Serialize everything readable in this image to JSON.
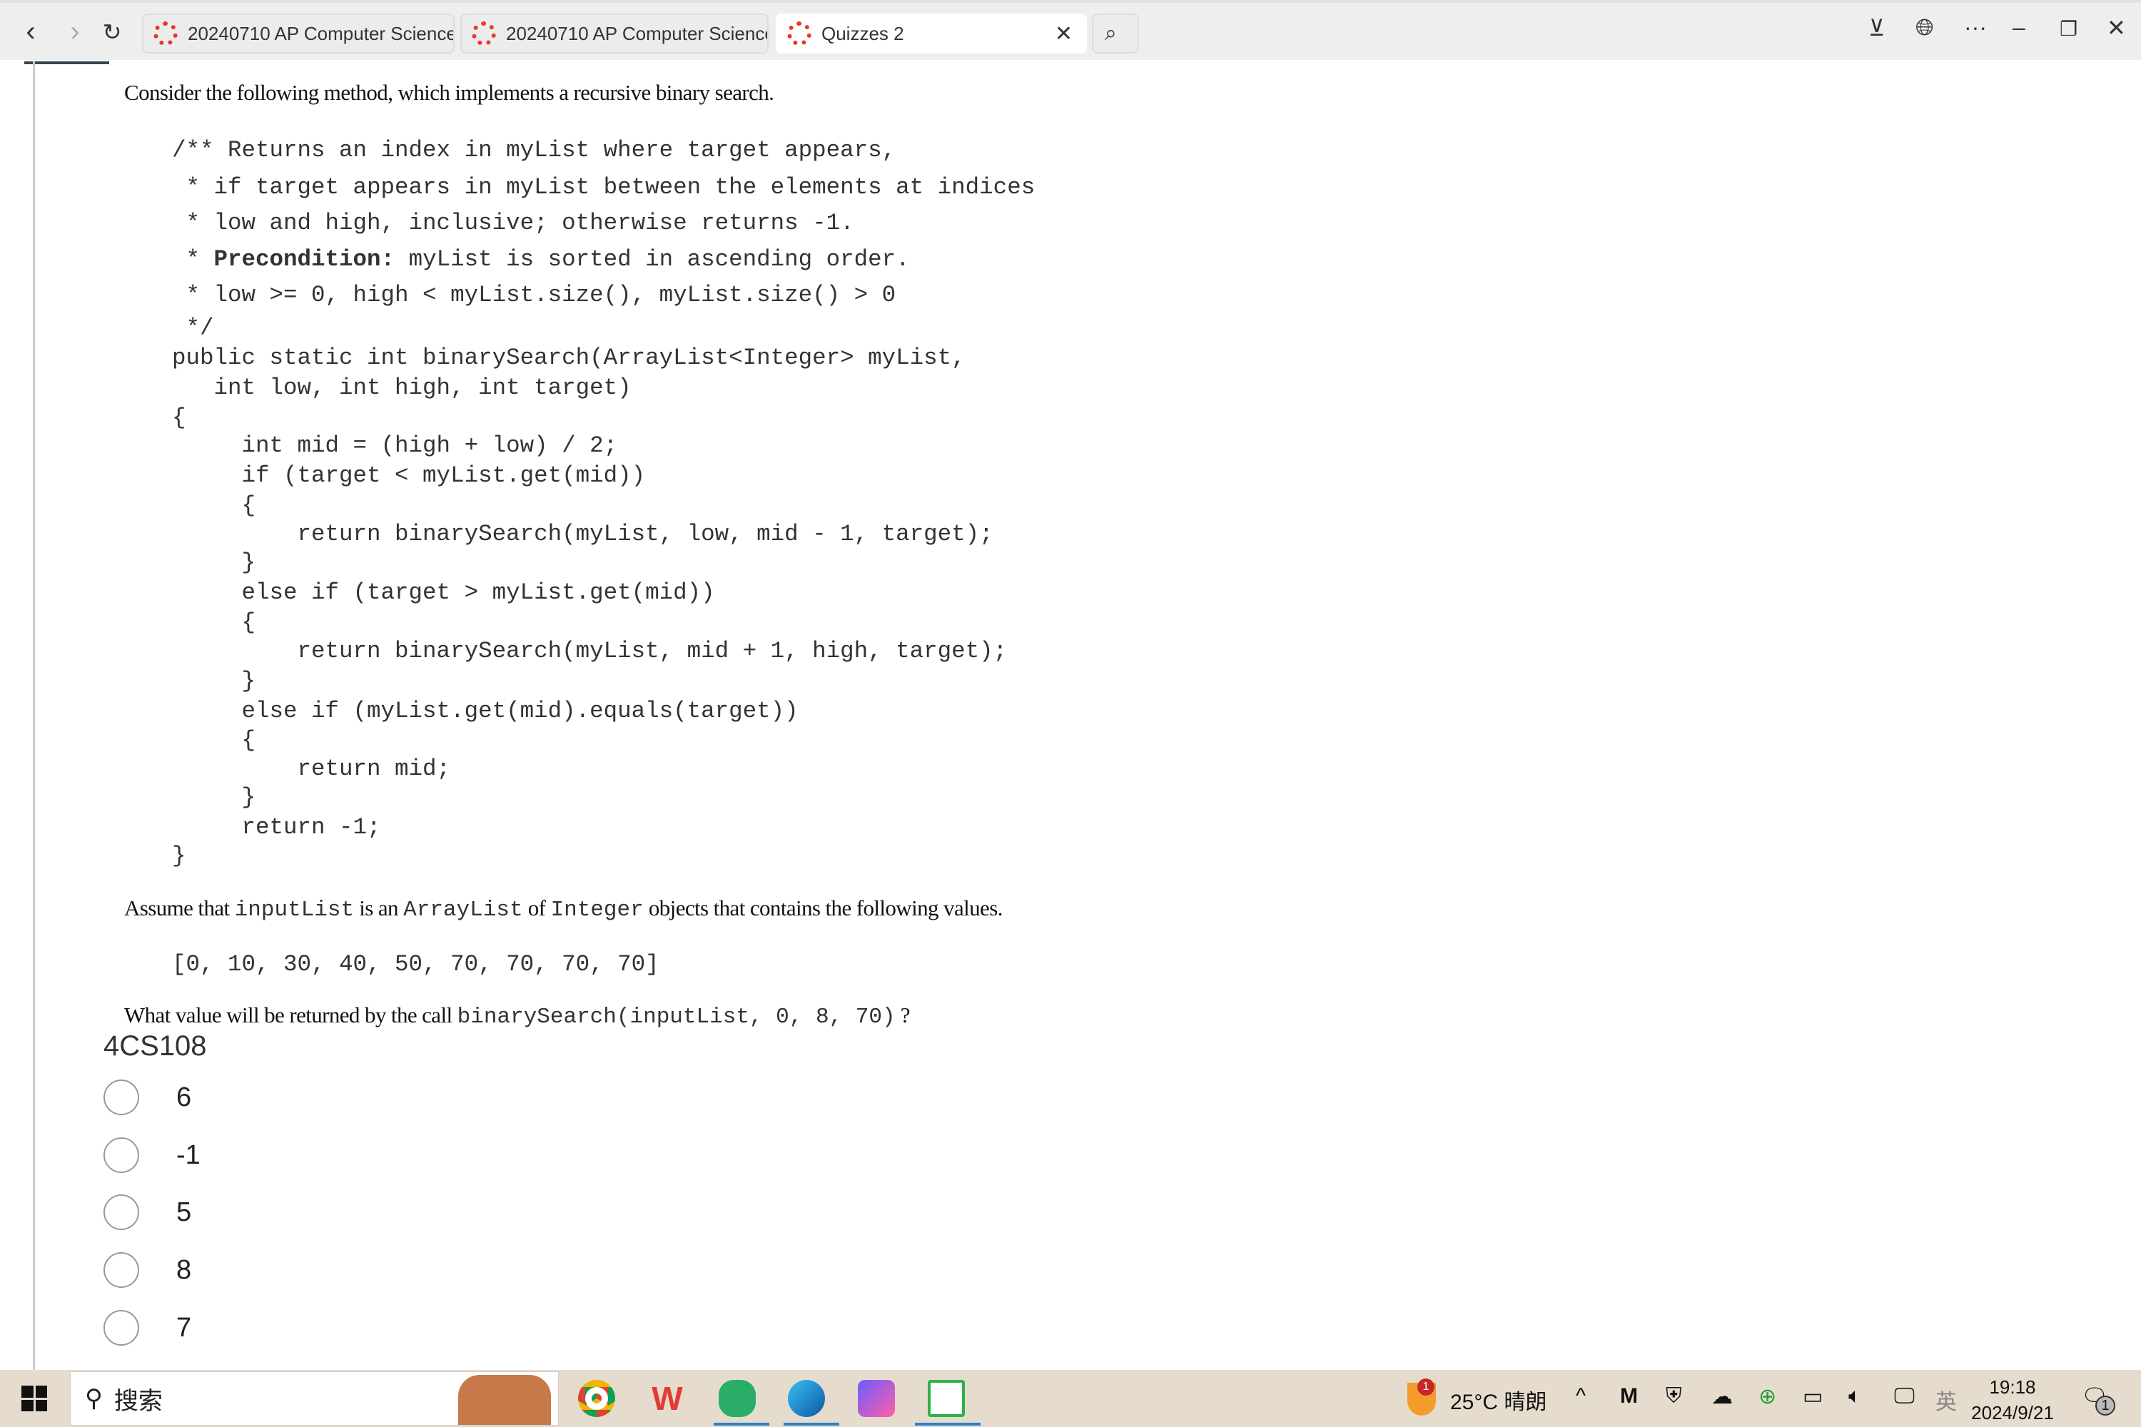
{
  "browser": {
    "tabs": [
      {
        "label": "20240710 AP Computer Science",
        "active": false
      },
      {
        "label": "20240710 AP Computer Science",
        "active": false
      },
      {
        "label": "Quizzes 2",
        "active": true
      }
    ],
    "icons": [
      "back-icon",
      "forward-icon",
      "refresh-icon",
      "search-tabs-icon",
      "download-icon",
      "globe-icon",
      "more-icon",
      "minimize-icon",
      "restore-icon",
      "close-icon"
    ]
  },
  "question": {
    "intro": "Consider the following method, which implements a recursive binary search.",
    "code": [
      "/** Returns an index in myList where target appears,",
      " * if target appears in myList between the elements at indices",
      " * low and high, inclusive; otherwise returns -1.",
      " * ",
      " * low >= 0, high < myList.size(), myList.size() > 0",
      " */",
      "public static int binarySearch(ArrayList<Integer> myList,",
      "   int low, int high, int target)",
      "{",
      "     int mid = (high + low) / 2;",
      "     if (target < myList.get(mid))",
      "     {",
      "         return binarySearch(myList, low, mid - 1, target);",
      "     }",
      "     else if (target > myList.get(mid))",
      "     {",
      "         return binarySearch(myList, mid + 1, high, target);",
      "     }",
      "     else if (myList.get(mid).equals(target))",
      "     {",
      "         return mid;",
      "     }",
      "     return -1;",
      "}"
    ],
    "precondition_label": "Precondition:",
    "precondition_text": " myList is sorted in ascending order.",
    "assume": {
      "p1": "Assume that ",
      "c1": "inputList",
      "p2": " is an ",
      "c2": "ArrayList",
      "p3": " of ",
      "c3": "Integer",
      "p4": " objects that contains the following values."
    },
    "values": "[0, 10, 30, 40, 50, 70, 70, 70, 70]",
    "ask": {
      "p1": "What value will be returned by the call ",
      "c1": "binarySearch(inputList, 0, 8, 70)",
      "p2": " ?"
    },
    "id": "4CS108",
    "options": [
      "6",
      "-1",
      "5",
      "8",
      "7"
    ],
    "selected": null
  },
  "taskbar": {
    "search_placeholder": "搜索",
    "weather": "25°C 晴朗",
    "weather_badge": "1",
    "ime": "英",
    "time": "19:18",
    "date": "2024/9/21",
    "notification_count": "1",
    "apps": [
      "chrome",
      "wps",
      "wechat",
      "edge",
      "app",
      "remote-desktop"
    ]
  }
}
